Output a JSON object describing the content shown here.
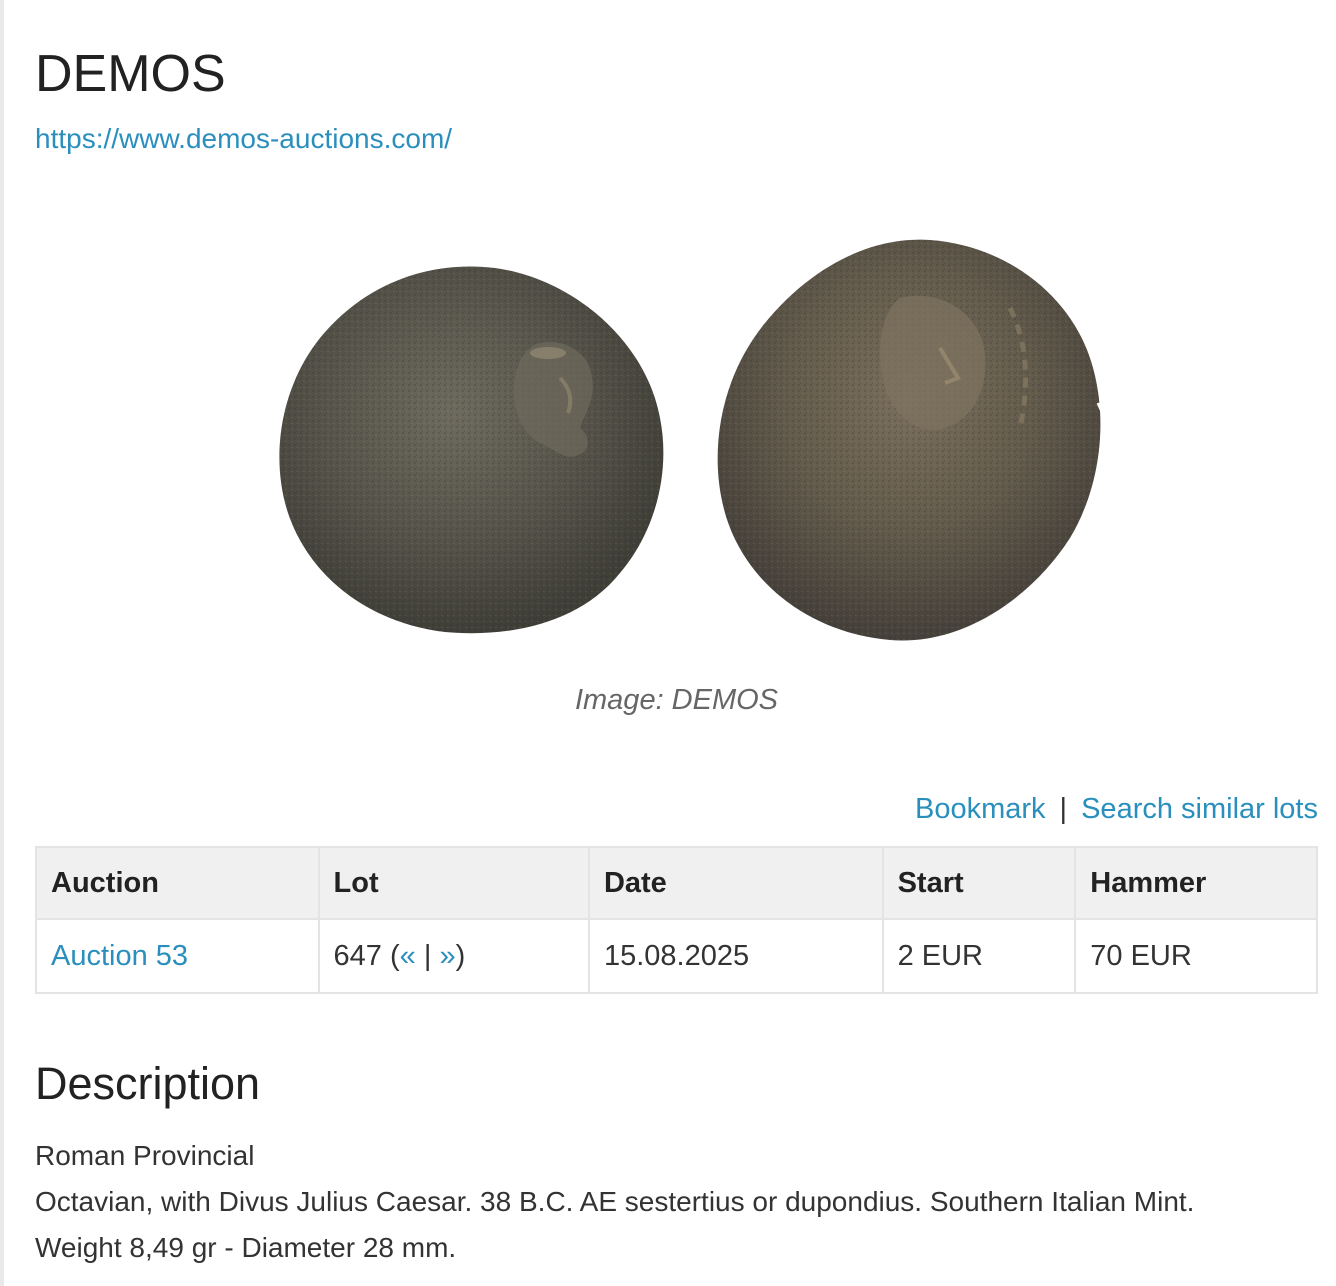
{
  "header": {
    "title": "DEMOS",
    "link": "https://www.demos-auctions.com/"
  },
  "image": {
    "caption": "Image: DEMOS"
  },
  "actions": {
    "bookmark": "Bookmark",
    "separator": "|",
    "search_similar": "Search similar lots"
  },
  "table": {
    "headers": [
      "Auction",
      "Lot",
      "Date",
      "Start",
      "Hammer"
    ],
    "row": {
      "auction": "Auction 53",
      "lot_number": "647",
      "lot_prev": "«",
      "lot_sep": "|",
      "lot_next": "»",
      "lot_open": "(",
      "lot_close": ")",
      "date": "15.08.2025",
      "start": "2 EUR",
      "hammer": "70 EUR"
    }
  },
  "description": {
    "heading": "Description",
    "lines": [
      "Roman Provincial",
      "Octavian, with Divus Julius Caesar. 38 B.C. AE sestertius or dupondius. Southern Italian Mint.",
      "Weight 8,49 gr - Diameter 28 mm."
    ]
  },
  "colors": {
    "link": "#2a8fbd",
    "header_bg": "#f0f0f0",
    "border": "#e4e4e4"
  }
}
